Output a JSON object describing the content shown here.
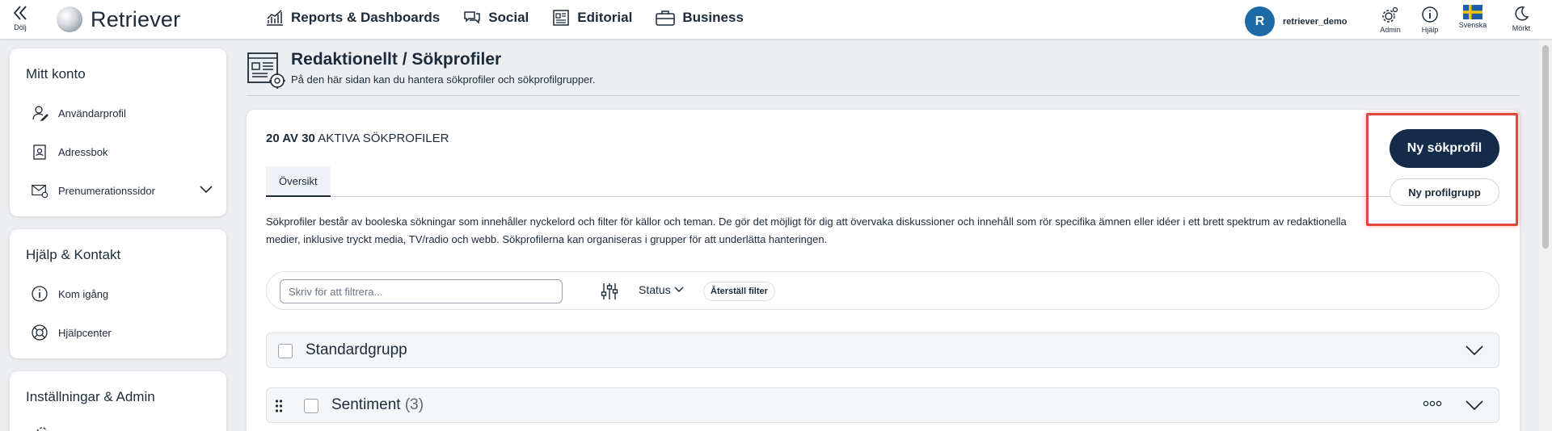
{
  "topbar": {
    "hide_label": "Dölj",
    "logo_text": "Retriever",
    "nav": [
      {
        "label": "Reports & Dashboards",
        "icon": "chart-icon"
      },
      {
        "label": "Social",
        "icon": "chat-icon"
      },
      {
        "label": "Editorial",
        "icon": "newspaper-icon"
      },
      {
        "label": "Business",
        "icon": "briefcase-icon"
      }
    ],
    "user": {
      "initial": "R",
      "name": "retriever_demo"
    },
    "utilities": {
      "admin": "Admin",
      "help": "Hjälp",
      "language": "Svenska",
      "theme": "Mörkt"
    }
  },
  "sidebar": {
    "account": {
      "title": "Mitt konto",
      "items": [
        {
          "label": "Användarprofil",
          "icon": "user-icon"
        },
        {
          "label": "Adressbok",
          "icon": "address-book-icon"
        },
        {
          "label": "Prenumerationssidor",
          "icon": "mail-icon"
        }
      ]
    },
    "help": {
      "title": "Hjälp & Kontakt",
      "items": [
        {
          "label": "Kom igång",
          "icon": "info-icon"
        },
        {
          "label": "Hjälpcenter",
          "icon": "lifebuoy-icon"
        }
      ]
    },
    "settings": {
      "title": "Inställningar & Admin"
    }
  },
  "page": {
    "title": "Redaktionellt / Sökprofiler",
    "subtitle": "På den här sidan kan du hantera sökprofiler och sökprofilgrupper."
  },
  "panel": {
    "count_bold": "20 AV 30",
    "count_rest": " AKTIVA SÖKPROFILER",
    "tab_overview": "Översikt",
    "description": "Sökprofiler består av booleska sökningar som innehåller nyckelord och filter för källor och teman. De gör det möjligt för dig att övervaka diskussioner och innehåll som rör specifika ämnen eller idéer i ett brett spektrum av redaktionella medier, inklusive tryckt media, TV/radio och webb. Sökprofilerna kan organiseras i grupper för att underlätta hanteringen.",
    "filter_placeholder": "Skriv för att filtrera...",
    "status_label": "Status",
    "reset_label": "Återställ filter",
    "new_profile_label": "Ny sökprofil",
    "new_group_label": "Ny profilgrupp",
    "groups": [
      {
        "name": "Standardgrupp",
        "count": ""
      },
      {
        "name": "Sentiment",
        "count": "(3)"
      }
    ]
  },
  "colors": {
    "primary": "#142b4a",
    "avatar": "#1e6aa6",
    "highlight": "#e0483c"
  }
}
